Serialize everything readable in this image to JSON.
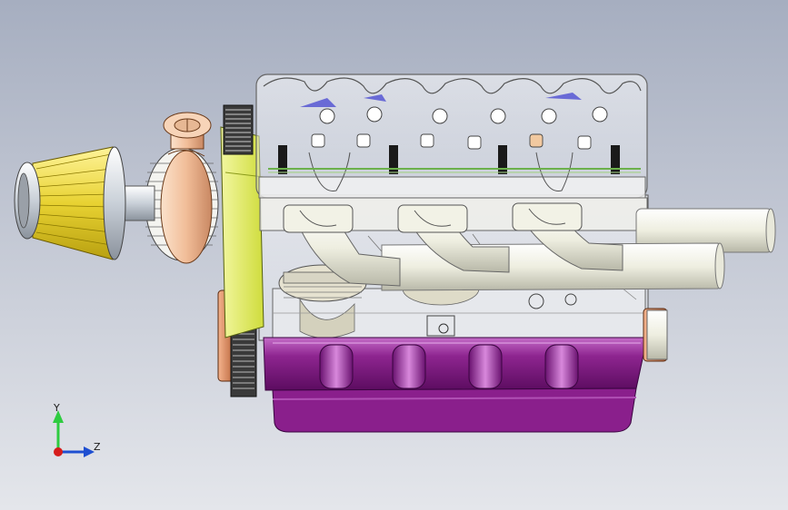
{
  "viewport": {
    "background_top": "#a6aec0",
    "background_bottom": "#e4e6eb"
  },
  "model": {
    "parts": [
      {
        "name": "air-filter",
        "color": "#f0e04a"
      },
      {
        "name": "turbocharger",
        "color": "#f2c6a6"
      },
      {
        "name": "timing-cover",
        "color": "#e6f06a"
      },
      {
        "name": "cylinder-head",
        "color": "#ffffff"
      },
      {
        "name": "exhaust-manifold",
        "color": "#f2f2e2"
      },
      {
        "name": "oil-pan",
        "color": "#8a1f8c"
      },
      {
        "name": "flywheel",
        "color": "#d8855a"
      }
    ]
  },
  "triad": {
    "y_label": "Y",
    "z_label": "Z",
    "y_color": "#2ecc40",
    "z_color": "#1f4fd1",
    "x_color": "#d61c1c"
  }
}
